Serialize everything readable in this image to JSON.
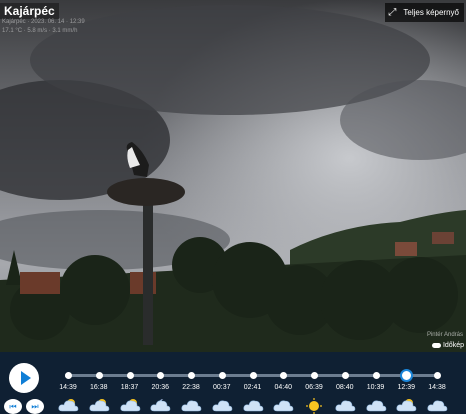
{
  "camera": {
    "title": "Kajárpéc",
    "overlay_line1": "Kajárpéc · 2023. 06. 14 · 12:39",
    "overlay_line2": "17.1 °C · 5.8 m/s · 3.1 mm/h",
    "credit": "Pintér András",
    "brand": "Időkép"
  },
  "toolbar": {
    "fullscreen_label": "Teljes képernyő"
  },
  "timeline": {
    "times": [
      "14:39",
      "16:38",
      "18:37",
      "20:36",
      "22:38",
      "00:37",
      "02:41",
      "04:40",
      "06:39",
      "08:40",
      "10:39",
      "12:39",
      "14:38"
    ],
    "selected_index": 11,
    "weather_icons": [
      "partly-cloudy-day-icon",
      "partly-cloudy-day-icon",
      "partly-cloudy-day-icon",
      "partly-cloudy-night-icon",
      "cloud-icon",
      "cloud-icon",
      "cloud-icon",
      "cloud-icon",
      "sun-icon",
      "cloud-icon",
      "cloud-icon",
      "partly-cloudy-day-icon",
      "cloud-icon"
    ]
  },
  "colors": {
    "panel_bg": "#0f2033",
    "accent": "#1a85d9"
  }
}
